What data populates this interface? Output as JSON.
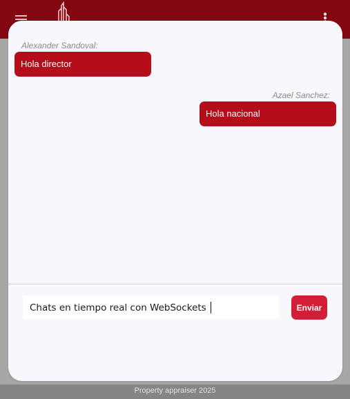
{
  "colors": {
    "appbar": "#830710",
    "bubble": "#b50d19",
    "send_button": "#d21f35",
    "card": "#f8f8fc",
    "backdrop": "#a7a7a8",
    "footer": "#858585"
  },
  "header": {
    "menu_icon": "menu-icon",
    "logo_icon": "building-logo-icon",
    "more_icon": "more-vertical-icon"
  },
  "chat": {
    "messages": [
      {
        "sender": "Alexander Sandoval:",
        "text": "Hola director",
        "align": "left"
      },
      {
        "sender": "Azael Sanchez:",
        "text": "Hola nacional",
        "align": "right"
      }
    ],
    "input_value": "Chats en tiempo real con WebSockets",
    "send_label": "Enviar"
  },
  "footer": {
    "text": "Property appraiser 2025"
  }
}
